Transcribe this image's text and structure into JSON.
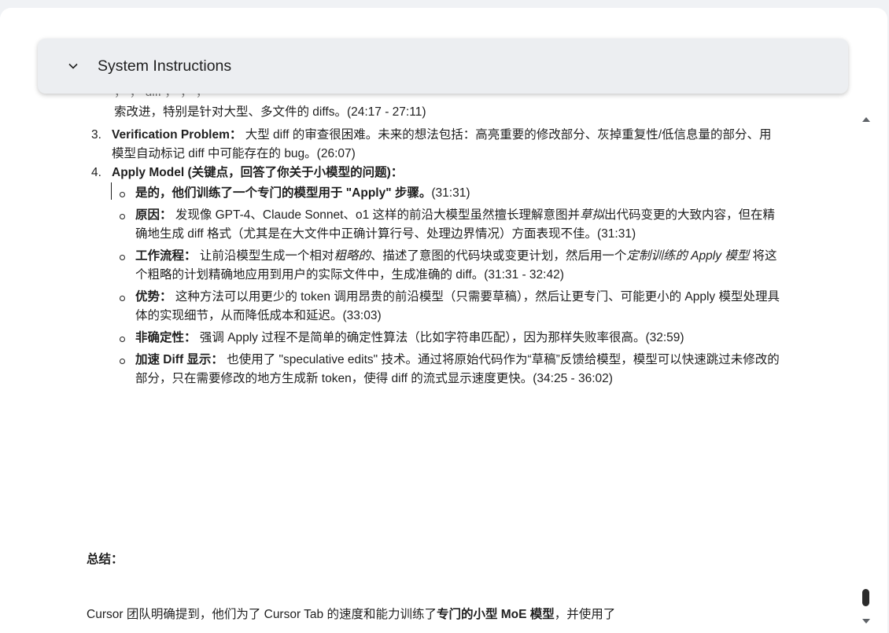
{
  "header": {
    "title": "System Instructions"
  },
  "content": {
    "partial_line1": "                     ，          ，          diff ，             ，          ，          ",
    "partial_line2": "索改进，特别是针对大型、多文件的 diffs。(24:17 - 27:11)",
    "items": [
      {
        "num": "3.",
        "bold": "Verification Problem：",
        "text": " 大型 diff 的审查很困难。未来的想法包括：高亮重要的修改部分、灰掉重复性/低信息量的部分、用模型自动标记 diff 中可能存在的 bug。(26:07)"
      },
      {
        "num": "4.",
        "bold": "Apply Model (关键点，回答了你关于小模型的问题)："
      }
    ],
    "sub": [
      {
        "bold": "是的，他们训练了一个专门的模型用于 \"Apply\" 步骤。",
        "text": "(31:31)"
      },
      {
        "bold": "原因：",
        "text_a": " 发现像 GPT-4、Claude Sonnet、o1 这样的前沿大模型虽然擅长理解意图并",
        "italic": "草拟",
        "text_b": "出代码变更的大致内容，但在精确地生成 diff 格式（尤其是在大文件中正确计算行号、处理边界情况）方面表现不佳。(31:31)"
      },
      {
        "bold": "工作流程：",
        "text_a": " 让前沿模型生成一个相对",
        "italic_a": "粗略的",
        "text_b": "、描述了意图的代码块或变更计划，然后用一个",
        "italic_b": "定制训练的 Apply 模型",
        "text_c": " 将这个粗略的计划精确地应用到用户的实际文件中，生成准确的 diff。(31:31 - 32:42)"
      },
      {
        "bold": "优势：",
        "text": " 这种方法可以用更少的 token 调用昂贵的前沿模型（只需要草稿），然后让更专门、可能更小的 Apply 模型处理具体的实现细节，从而降低成本和延迟。(33:03)"
      },
      {
        "bold": "非确定性：",
        "text": " 强调 Apply 过程不是简单的确定性算法（比如字符串匹配），因为那样失败率很高。(32:59)"
      },
      {
        "bold": "加速 Diff 显示：",
        "text": " 也使用了 \"speculative edits\" 技术。通过将原始代码作为“草稿”反馈给模型，模型可以快速跳过未修改的部分，只在需要修改的地方生成新 token，使得 diff 的流式显示速度更快。(34:25 - 36:02)"
      }
    ],
    "summary_heading": "总结：",
    "summary_text_a": "Cursor 团队明确提到，他们为了 Cursor Tab 的速度和能力训练了",
    "summary_bold": "专门的小型 MoE 模型",
    "summary_text_b": "，并使用了"
  },
  "icons": {
    "header_toggle": "chevron-down-icon",
    "scroll_up": "arrow-up-icon",
    "scroll_down": "arrow-down-icon"
  }
}
